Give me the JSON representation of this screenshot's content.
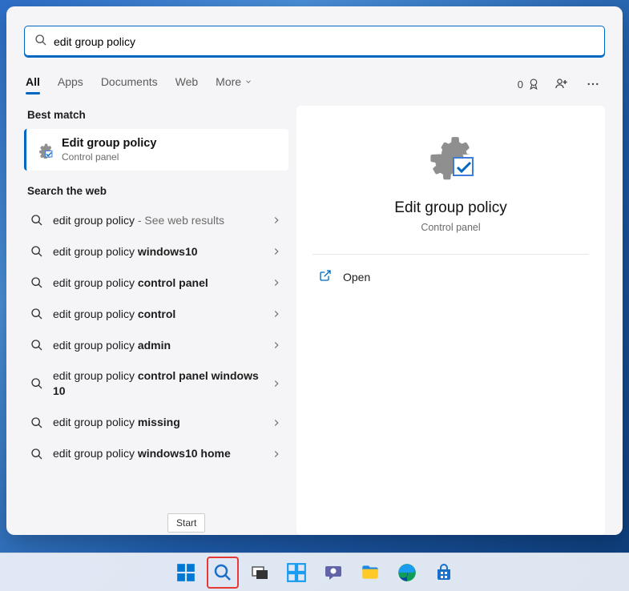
{
  "search": {
    "value": "edit group policy"
  },
  "tabs": {
    "all": "All",
    "apps": "Apps",
    "documents": "Documents",
    "web": "Web",
    "more": "More"
  },
  "header": {
    "rewards_count": "0"
  },
  "sections": {
    "best_match": "Best match",
    "search_web": "Search the web"
  },
  "best_match": {
    "title": "Edit group policy",
    "subtitle": "Control panel"
  },
  "web_results": [
    {
      "prefix": "edit group policy",
      "bold": "",
      "hint": " - See web results"
    },
    {
      "prefix": "edit group policy ",
      "bold": "windows10",
      "hint": ""
    },
    {
      "prefix": "edit group policy ",
      "bold": "control panel",
      "hint": ""
    },
    {
      "prefix": "edit group policy ",
      "bold": "control",
      "hint": ""
    },
    {
      "prefix": "edit group policy ",
      "bold": "admin",
      "hint": ""
    },
    {
      "prefix": "edit group policy ",
      "bold": "control panel windows 10",
      "hint": ""
    },
    {
      "prefix": "edit group policy ",
      "bold": "missing",
      "hint": ""
    },
    {
      "prefix": "edit group policy ",
      "bold": "windows10 home",
      "hint": ""
    }
  ],
  "detail": {
    "title": "Edit group policy",
    "subtitle": "Control panel",
    "action_open": "Open"
  },
  "tooltip": {
    "start": "Start"
  }
}
